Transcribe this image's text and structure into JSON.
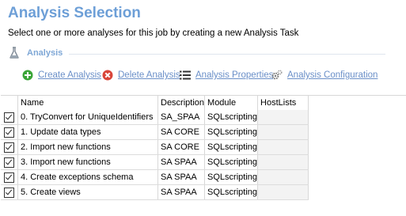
{
  "header": {
    "title": "Analysis Selection",
    "subtitle": "Select one or more analyses for this job by creating a new Analysis Task"
  },
  "section": {
    "label": "Analysis"
  },
  "toolbar": {
    "create_label": "Create Analysis",
    "delete_label": "Delete Analysis",
    "properties_label": "Analysis Properties",
    "configuration_label": "Analysis Configuration"
  },
  "grid": {
    "columns": [
      "Name",
      "Description",
      "Module",
      "HostLists"
    ],
    "rows": [
      {
        "checked": true,
        "name": "0. TryConvert for UniqueIdentifiers",
        "description": "SA_SPAA",
        "module": "SQLscripting",
        "hostlists": ""
      },
      {
        "checked": true,
        "name": "1. Update data types",
        "description": "SA CORE",
        "module": "SQLscripting",
        "hostlists": ""
      },
      {
        "checked": true,
        "name": "2. Import new functions",
        "description": "SA CORE",
        "module": "SQLscripting",
        "hostlists": ""
      },
      {
        "checked": true,
        "name": "3. Import new functions",
        "description": "SA SPAA",
        "module": "SQLscripting",
        "hostlists": ""
      },
      {
        "checked": true,
        "name": "4. Create exceptions schema",
        "description": "SA SPAA",
        "module": "SQLscripting",
        "hostlists": ""
      },
      {
        "checked": true,
        "name": "5. Create views",
        "description": "SA SPAA",
        "module": "SQLscripting",
        "hostlists": ""
      }
    ]
  },
  "colors": {
    "title": "#6d9fd7",
    "link": "#6a8fc8",
    "create_icon": "#3aa537",
    "delete_icon": "#d9453a"
  },
  "icons": {
    "section": "flask-icon",
    "create": "plus-circle-icon",
    "delete": "delete-circle-icon",
    "properties": "list-icon",
    "configuration": "gears-icon"
  }
}
